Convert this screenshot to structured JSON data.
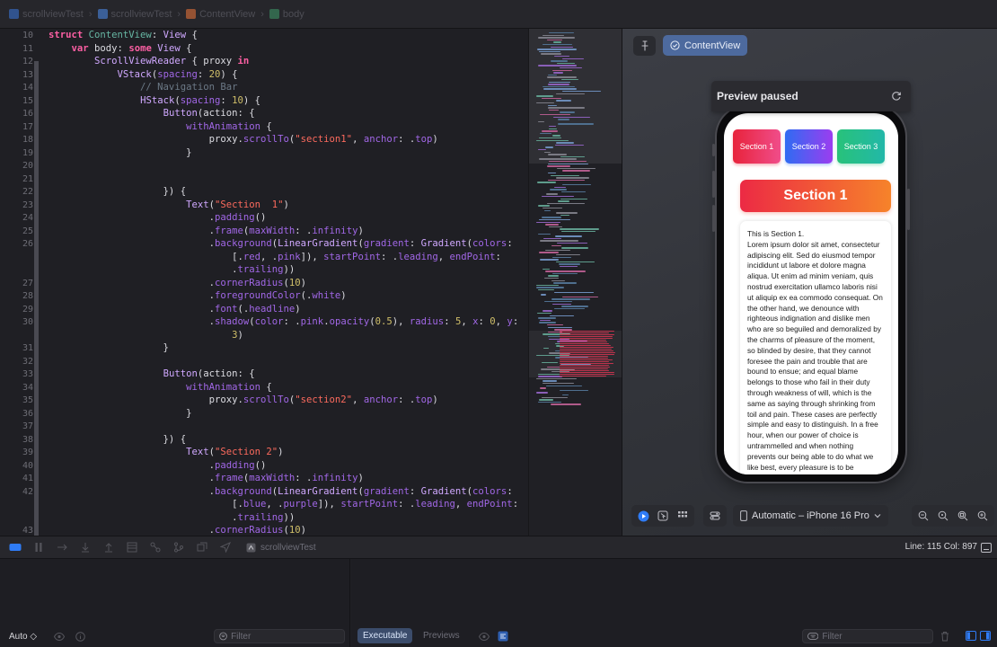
{
  "breadcrumb": [
    {
      "label": "scrollviewTest",
      "icon": "project-icon",
      "color": "#3a78e0"
    },
    {
      "label": "scrollviewTest",
      "icon": "folder-icon",
      "color": "#4d8ef0"
    },
    {
      "label": "ContentView",
      "icon": "swift-file-icon",
      "color": "#f0763a"
    },
    {
      "label": "body",
      "icon": "property-icon",
      "color": "#3f9c6a"
    }
  ],
  "code_lines": [
    {
      "n": "10",
      "tokens": [
        [
          "kw",
          "struct "
        ],
        [
          "id",
          "ContentView"
        ],
        [
          "plain",
          ": "
        ],
        [
          "type",
          "View"
        ],
        [
          "plain",
          " {"
        ]
      ]
    },
    {
      "n": "11",
      "tokens": [
        [
          "plain",
          "    "
        ],
        [
          "kw",
          "var "
        ],
        [
          "plain",
          "body: "
        ],
        [
          "kw",
          "some "
        ],
        [
          "type",
          "View"
        ],
        [
          "plain",
          " {"
        ]
      ]
    },
    {
      "n": "12",
      "tokens": [
        [
          "plain",
          "        "
        ],
        [
          "type",
          "ScrollViewReader"
        ],
        [
          "plain",
          " { proxy "
        ],
        [
          "kw",
          "in"
        ]
      ]
    },
    {
      "n": "13",
      "tokens": [
        [
          "plain",
          "            "
        ],
        [
          "type",
          "VStack"
        ],
        [
          "plain",
          "("
        ],
        [
          "fn",
          "spacing"
        ],
        [
          "plain",
          ": "
        ],
        [
          "num",
          "20"
        ],
        [
          "plain",
          ") {"
        ]
      ]
    },
    {
      "n": "14",
      "tokens": [
        [
          "cmt",
          "                // Navigation Bar"
        ]
      ]
    },
    {
      "n": "15",
      "tokens": [
        [
          "plain",
          "                "
        ],
        [
          "type",
          "HStack"
        ],
        [
          "plain",
          "("
        ],
        [
          "fn",
          "spacing"
        ],
        [
          "plain",
          ": "
        ],
        [
          "num",
          "10"
        ],
        [
          "plain",
          ") {"
        ]
      ]
    },
    {
      "n": "16",
      "tokens": [
        [
          "plain",
          "                    "
        ],
        [
          "type",
          "Button"
        ],
        [
          "plain",
          "(action: {"
        ]
      ]
    },
    {
      "n": "17",
      "tokens": [
        [
          "plain",
          "                        "
        ],
        [
          "fn",
          "withAnimation"
        ],
        [
          "plain",
          " {"
        ]
      ]
    },
    {
      "n": "18",
      "tokens": [
        [
          "plain",
          "                            proxy."
        ],
        [
          "fn",
          "scrollTo"
        ],
        [
          "plain",
          "("
        ],
        [
          "str",
          "\"section1\""
        ],
        [
          "plain",
          ", "
        ],
        [
          "fn",
          "anchor"
        ],
        [
          "plain",
          ": ."
        ],
        [
          "fn",
          "top"
        ],
        [
          "plain",
          ")"
        ]
      ]
    },
    {
      "n": "19",
      "tokens": [
        [
          "plain",
          "                        }"
        ]
      ]
    },
    {
      "n": "20",
      "tokens": []
    },
    {
      "n": "21",
      "tokens": []
    },
    {
      "n": "22",
      "tokens": [
        [
          "plain",
          "                    }) {"
        ]
      ]
    },
    {
      "n": "23",
      "tokens": [
        [
          "plain",
          "                        "
        ],
        [
          "type",
          "Text"
        ],
        [
          "plain",
          "("
        ],
        [
          "str",
          "\"Section  1\""
        ],
        [
          "plain",
          ")"
        ]
      ]
    },
    {
      "n": "24",
      "tokens": [
        [
          "plain",
          "                            ."
        ],
        [
          "fn",
          "padding"
        ],
        [
          "plain",
          "()"
        ]
      ]
    },
    {
      "n": "25",
      "tokens": [
        [
          "plain",
          "                            ."
        ],
        [
          "fn",
          "frame"
        ],
        [
          "plain",
          "("
        ],
        [
          "fn",
          "maxWidth"
        ],
        [
          "plain",
          ": ."
        ],
        [
          "fn",
          "infinity"
        ],
        [
          "plain",
          ")"
        ]
      ]
    },
    {
      "n": "26",
      "tokens": [
        [
          "plain",
          "                            ."
        ],
        [
          "fn",
          "background"
        ],
        [
          "plain",
          "("
        ],
        [
          "type",
          "LinearGradient"
        ],
        [
          "plain",
          "("
        ],
        [
          "fn",
          "gradient"
        ],
        [
          "plain",
          ": "
        ],
        [
          "type",
          "Gradient"
        ],
        [
          "plain",
          "("
        ],
        [
          "fn",
          "colors"
        ],
        [
          "plain",
          ":"
        ]
      ]
    },
    {
      "n": "",
      "tokens": [
        [
          "plain",
          "                                [."
        ],
        [
          "fn",
          "red"
        ],
        [
          "plain",
          ", ."
        ],
        [
          "fn",
          "pink"
        ],
        [
          "plain",
          "]), "
        ],
        [
          "fn",
          "startPoint"
        ],
        [
          "plain",
          ": ."
        ],
        [
          "fn",
          "leading"
        ],
        [
          "plain",
          ", "
        ],
        [
          "fn",
          "endPoint"
        ],
        [
          "plain",
          ":"
        ]
      ]
    },
    {
      "n": "",
      "tokens": [
        [
          "plain",
          "                                ."
        ],
        [
          "fn",
          "trailing"
        ],
        [
          "plain",
          "))"
        ]
      ]
    },
    {
      "n": "27",
      "tokens": [
        [
          "plain",
          "                            ."
        ],
        [
          "fn",
          "cornerRadius"
        ],
        [
          "plain",
          "("
        ],
        [
          "num",
          "10"
        ],
        [
          "plain",
          ")"
        ]
      ]
    },
    {
      "n": "28",
      "tokens": [
        [
          "plain",
          "                            ."
        ],
        [
          "fn",
          "foregroundColor"
        ],
        [
          "plain",
          "(."
        ],
        [
          "fn",
          "white"
        ],
        [
          "plain",
          ")"
        ]
      ]
    },
    {
      "n": "29",
      "tokens": [
        [
          "plain",
          "                            ."
        ],
        [
          "fn",
          "font"
        ],
        [
          "plain",
          "(."
        ],
        [
          "fn",
          "headline"
        ],
        [
          "plain",
          ")"
        ]
      ]
    },
    {
      "n": "30",
      "tokens": [
        [
          "plain",
          "                            ."
        ],
        [
          "fn",
          "shadow"
        ],
        [
          "plain",
          "("
        ],
        [
          "fn",
          "color"
        ],
        [
          "plain",
          ": ."
        ],
        [
          "fn",
          "pink"
        ],
        [
          "plain",
          "."
        ],
        [
          "fn",
          "opacity"
        ],
        [
          "plain",
          "("
        ],
        [
          "num",
          "0.5"
        ],
        [
          "plain",
          "), "
        ],
        [
          "fn",
          "radius"
        ],
        [
          "plain",
          ": "
        ],
        [
          "num",
          "5"
        ],
        [
          "plain",
          ", "
        ],
        [
          "fn",
          "x"
        ],
        [
          "plain",
          ": "
        ],
        [
          "num",
          "0"
        ],
        [
          "plain",
          ", "
        ],
        [
          "fn",
          "y"
        ],
        [
          "plain",
          ":"
        ]
      ]
    },
    {
      "n": "",
      "tokens": [
        [
          "plain",
          "                                "
        ],
        [
          "num",
          "3"
        ],
        [
          "plain",
          ")"
        ]
      ]
    },
    {
      "n": "31",
      "tokens": [
        [
          "plain",
          "                    }"
        ]
      ]
    },
    {
      "n": "32",
      "tokens": []
    },
    {
      "n": "33",
      "tokens": [
        [
          "plain",
          "                    "
        ],
        [
          "type",
          "Button"
        ],
        [
          "plain",
          "(action: {"
        ]
      ]
    },
    {
      "n": "34",
      "tokens": [
        [
          "plain",
          "                        "
        ],
        [
          "fn",
          "withAnimation"
        ],
        [
          "plain",
          " {"
        ]
      ]
    },
    {
      "n": "35",
      "tokens": [
        [
          "plain",
          "                            proxy."
        ],
        [
          "fn",
          "scrollTo"
        ],
        [
          "plain",
          "("
        ],
        [
          "str",
          "\"section2\""
        ],
        [
          "plain",
          ", "
        ],
        [
          "fn",
          "anchor"
        ],
        [
          "plain",
          ": ."
        ],
        [
          "fn",
          "top"
        ],
        [
          "plain",
          ")"
        ]
      ]
    },
    {
      "n": "36",
      "tokens": [
        [
          "plain",
          "                        }"
        ]
      ]
    },
    {
      "n": "37",
      "tokens": []
    },
    {
      "n": "38",
      "tokens": [
        [
          "plain",
          "                    }) {"
        ]
      ]
    },
    {
      "n": "39",
      "tokens": [
        [
          "plain",
          "                        "
        ],
        [
          "type",
          "Text"
        ],
        [
          "plain",
          "("
        ],
        [
          "str",
          "\"Section 2\""
        ],
        [
          "plain",
          ")"
        ]
      ]
    },
    {
      "n": "40",
      "tokens": [
        [
          "plain",
          "                            ."
        ],
        [
          "fn",
          "padding"
        ],
        [
          "plain",
          "()"
        ]
      ]
    },
    {
      "n": "41",
      "tokens": [
        [
          "plain",
          "                            ."
        ],
        [
          "fn",
          "frame"
        ],
        [
          "plain",
          "("
        ],
        [
          "fn",
          "maxWidth"
        ],
        [
          "plain",
          ": ."
        ],
        [
          "fn",
          "infinity"
        ],
        [
          "plain",
          ")"
        ]
      ]
    },
    {
      "n": "42",
      "tokens": [
        [
          "plain",
          "                            ."
        ],
        [
          "fn",
          "background"
        ],
        [
          "plain",
          "("
        ],
        [
          "type",
          "LinearGradient"
        ],
        [
          "plain",
          "("
        ],
        [
          "fn",
          "gradient"
        ],
        [
          "plain",
          ": "
        ],
        [
          "type",
          "Gradient"
        ],
        [
          "plain",
          "("
        ],
        [
          "fn",
          "colors"
        ],
        [
          "plain",
          ":"
        ]
      ]
    },
    {
      "n": "",
      "tokens": [
        [
          "plain",
          "                                [."
        ],
        [
          "fn",
          "blue"
        ],
        [
          "plain",
          ", ."
        ],
        [
          "fn",
          "purple"
        ],
        [
          "plain",
          "]), "
        ],
        [
          "fn",
          "startPoint"
        ],
        [
          "plain",
          ": ."
        ],
        [
          "fn",
          "leading"
        ],
        [
          "plain",
          ", "
        ],
        [
          "fn",
          "endPoint"
        ],
        [
          "plain",
          ":"
        ]
      ]
    },
    {
      "n": "",
      "tokens": [
        [
          "plain",
          "                                ."
        ],
        [
          "fn",
          "trailing"
        ],
        [
          "plain",
          "))"
        ]
      ]
    },
    {
      "n": "43",
      "tokens": [
        [
          "plain",
          "                            ."
        ],
        [
          "fn",
          "cornerRadius"
        ],
        [
          "plain",
          "("
        ],
        [
          "num",
          "10"
        ],
        [
          "plain",
          ")"
        ]
      ]
    }
  ],
  "canvas": {
    "preview_tab_label": "ContentView",
    "paused_label": "Preview paused",
    "device_label": "Automatic – iPhone 16 Pro"
  },
  "app_preview": {
    "buttons": [
      {
        "label": "Section 1",
        "color_from": "#e8233b",
        "color_to": "#f04d8a"
      },
      {
        "label": "Section 2",
        "color_from": "#2f6cf2",
        "color_to": "#9b3df0"
      },
      {
        "label": "Section 3",
        "color_from": "#28c27a",
        "color_to": "#22b8a8"
      }
    ],
    "section_title": "Section 1",
    "section_text": "This is Section 1.\nLorem ipsum dolor sit amet, consectetur adipiscing elit. Sed do eiusmod tempor incididunt ut labore et dolore magna aliqua. Ut enim ad minim veniam, quis nostrud exercitation ullamco laboris nisi ut aliquip ex ea commodo consequat.    On the other hand, we denounce with righteous indignation and dislike men who are so beguiled and demoralized by the charms of pleasure of the moment, so blinded by desire, that they cannot foresee the pain and trouble that are bound to ensue; and equal blame belongs to those who fail in their duty through weakness of will, which is the same as saying through shrinking from toil and pain. These cases are perfectly simple and easy to distinguish. In a free hour, when our power of choice is untrammelled and when nothing prevents our being able to do what we like best, every pleasure is to be"
  },
  "debugbar": {
    "scheme_label": "scrollviewTest",
    "cursor_position": "Line: 115  Col: 897"
  },
  "variables_pane": {
    "auto_label": "Auto ◇",
    "filter_placeholder": "Filter"
  },
  "console_pane": {
    "executable_tab": "Executable",
    "previews_tab": "Previews",
    "filter_placeholder": "Filter"
  }
}
